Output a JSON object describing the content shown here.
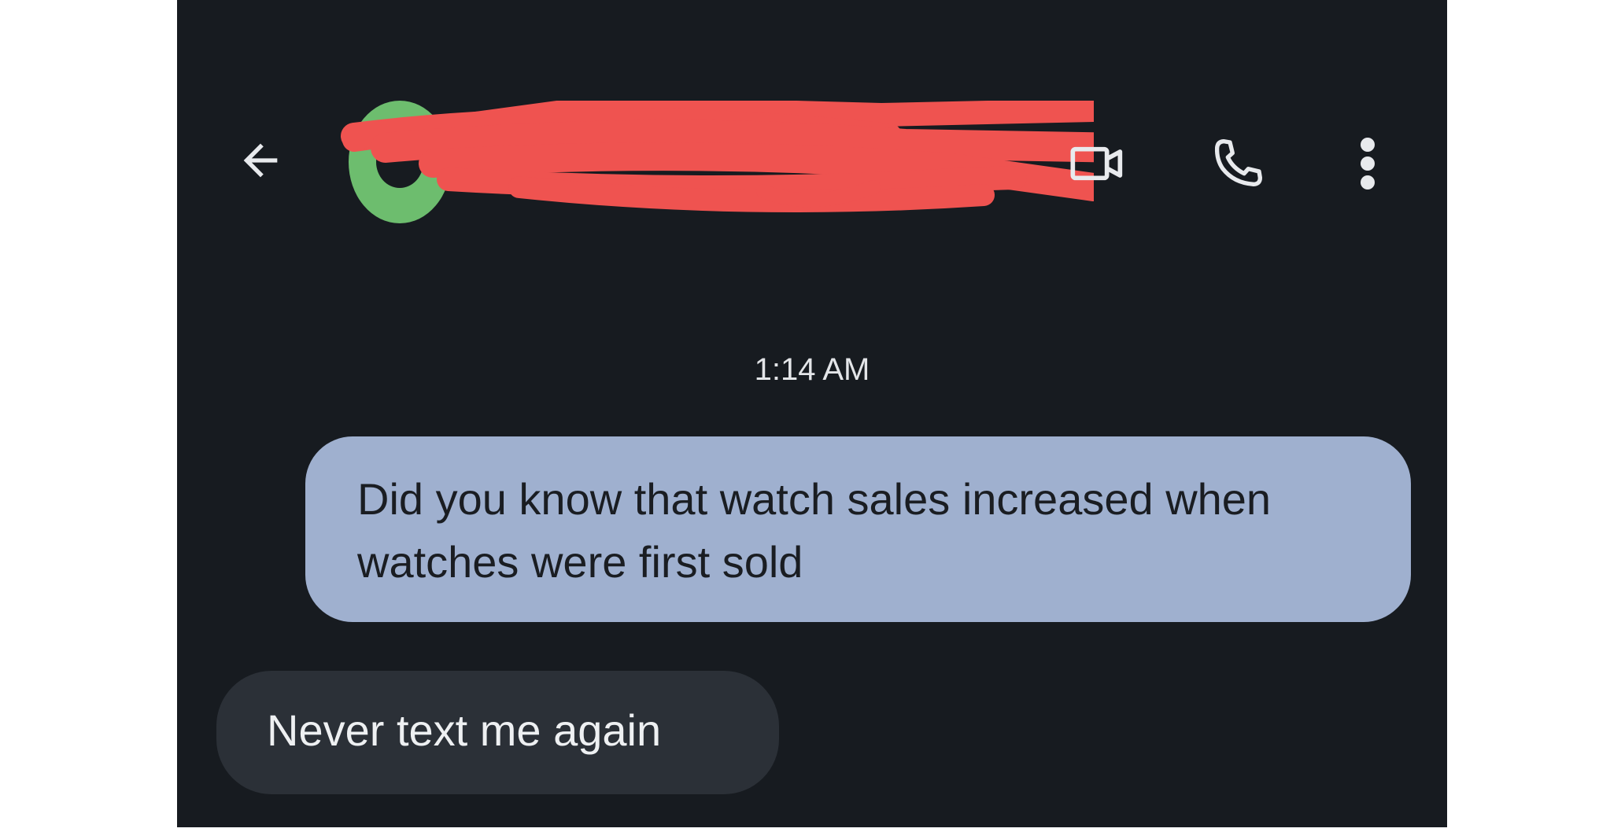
{
  "header": {
    "contact_name": "",
    "avatar_color": "#6dbd6e",
    "redaction_color": "#ef5350",
    "icons": {
      "back": "arrow-back-icon",
      "video": "video-call-icon",
      "phone": "phone-call-icon",
      "more": "more-vert-icon"
    }
  },
  "conversation": {
    "timestamp": "1:14 AM",
    "messages": [
      {
        "direction": "outgoing",
        "text": "Did you know that watch sales increased when watches were first sold",
        "bubble_color": "#9fb0cf"
      },
      {
        "direction": "incoming",
        "text": "Never text me again",
        "bubble_color": "#2b3037"
      }
    ]
  },
  "theme": {
    "background": "#171b20",
    "text_light": "#e3e5e8"
  }
}
